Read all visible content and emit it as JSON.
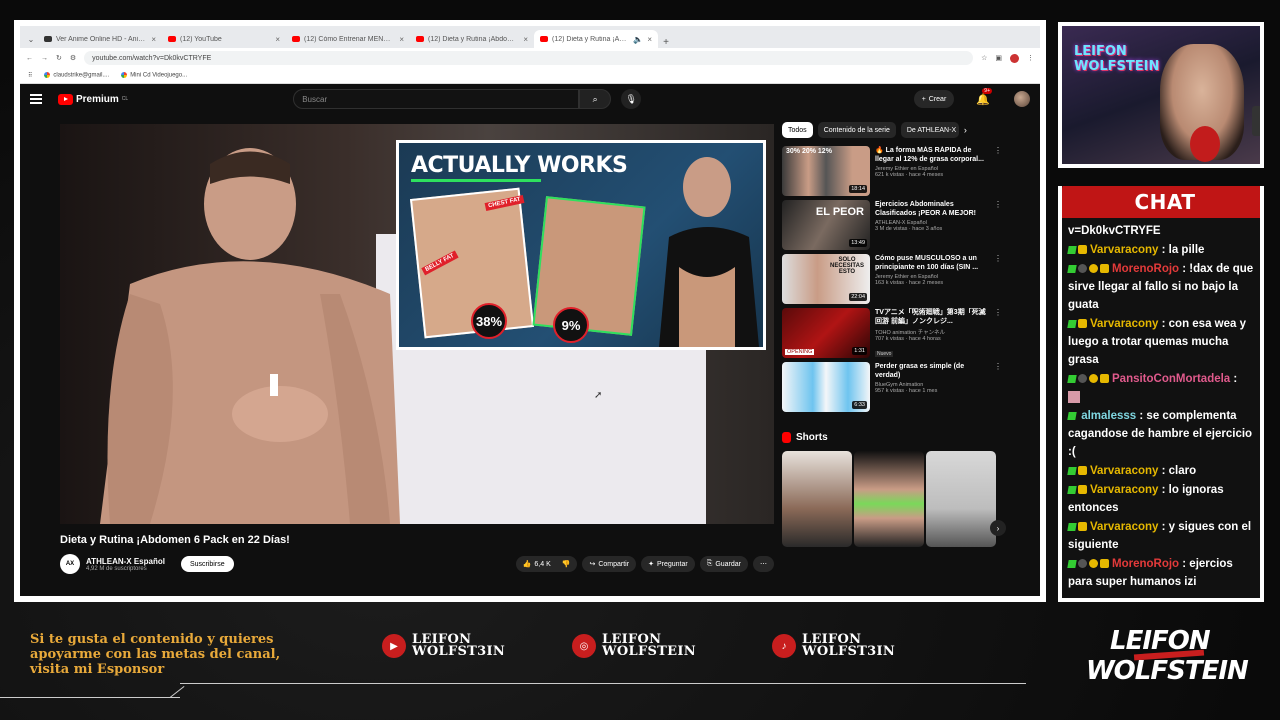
{
  "browser": {
    "tabs": [
      {
        "title": "Ver Anime Online HD - Animefl",
        "active": false
      },
      {
        "title": "(12) YouTube",
        "active": false
      },
      {
        "title": "(12) Cómo Entrenar MENOS co",
        "active": false
      },
      {
        "title": "(12) Dieta y Rutina ¡Abdomen 6",
        "active": false
      },
      {
        "title": "(12) Dieta y Rutina ¡Abdom",
        "active": true
      }
    ],
    "url": "youtube.com/watch?v=Dk0kvCTRYFE",
    "bookmarks": [
      "claudstrike@gmail....",
      "Mini Cd Videojuego..."
    ]
  },
  "youtube": {
    "logo": "Premium",
    "logo_region": "CL",
    "search_placeholder": "Buscar",
    "create_label": "Crear",
    "notif_count": "9+",
    "player_overlay": {
      "headline": "ACTUALLY WORKS",
      "tag1": "CHEST FAT",
      "tag2": "BELLY FAT",
      "pct1": "38%",
      "pct2": "9%"
    },
    "video_title": "Dieta y Rutina ¡Abdomen 6 Pack en 22 Días!",
    "channel": {
      "logo": "AX",
      "name": "ATHLEAN-X Español",
      "subs": "4,92 M de suscriptores",
      "subscribe": "Suscribirse"
    },
    "actions": {
      "likes": "6,4 K",
      "share": "Compartir",
      "ask": "Preguntar",
      "save": "Guardar"
    },
    "chips": [
      "Todos",
      "Contenido de la serie",
      "De ATHLEAN-X"
    ],
    "recommendations": [
      {
        "title": "🔥 La forma MÁS RÁPIDA de llegar al 12% de grasa corporal...",
        "channel": "Jeremy Ethier en Español",
        "meta": "621 k vistas · hace 4 meses",
        "duration": "18:14",
        "thumb_text": "30%  20%  12%"
      },
      {
        "title": "Ejercicios Abdominales Clasificados ¡PEOR A MEJOR!",
        "channel": "ATHLEAN-X Español",
        "meta": "3 M de vistas · hace 3 años",
        "duration": "13:49",
        "thumb_text": "EL PEOR"
      },
      {
        "title": "Cómo puse MUSCULOSO a un principiante en 100 días (SIN ...",
        "channel": "Jeremy Ethier en Español",
        "meta": "163 k vistas · hace 2 meses",
        "duration": "22:04",
        "thumb_text": "SOLO NECESITAS ESTO"
      },
      {
        "title": "TVアニメ「呪術廻戦」第3期「死滅回游 前編」ノンクレジ...",
        "channel": "TOHO animation チャンネル",
        "meta": "707 k vistas · hace 4 horas",
        "duration": "1:31",
        "badge": "Nuevo",
        "thumb_text": "OPENING"
      },
      {
        "title": "Perder grasa es simple (de verdad)",
        "channel": "BlueGym Animation",
        "meta": "957 k vistas · hace 1 mes",
        "duration": "6:33",
        "thumb_text": ""
      }
    ],
    "shorts_label": "Shorts"
  },
  "webcam": {
    "name_line1": "LEIFON",
    "name_line2": "WOLFSTEIN"
  },
  "chat": {
    "title": "CHAT",
    "messages": [
      {
        "user": "",
        "text": "v=Dk0kvCTRYFE"
      },
      {
        "user": "Varvaracony",
        "text": ": la pille"
      },
      {
        "user": "MorenoRojo",
        "text": ": !dax de que sirve llegar al fallo si no bajo la guata"
      },
      {
        "user": "Varvaracony",
        "text": ": con esa wea y luego a trotar quemas mucha grasa"
      },
      {
        "user": "PansitoConMortadela",
        "text": ":"
      },
      {
        "user": "almalesss",
        "text": ": se complementa cagandose de hambre el ejercicio :("
      },
      {
        "user": "Varvaracony",
        "text": ": claro"
      },
      {
        "user": "Varvaracony",
        "text": ": lo ignoras entonces"
      },
      {
        "user": "Varvaracony",
        "text": ": y sigues con el siguiente"
      },
      {
        "user": "MorenoRojo",
        "text": ": ejercios para super humanos izi"
      }
    ]
  },
  "footer": {
    "sponsor_text": "Si te gusta el contenido y quieres apoyarme con las metas del canal, visita mi Esponsor",
    "socials": [
      {
        "network": "youtube",
        "name_line1": "LEIFON",
        "name_line2": "WOLFST3IN"
      },
      {
        "network": "instagram",
        "name_line1": "LEIFON",
        "name_line2": "WOLFSTEIN"
      },
      {
        "network": "tiktok",
        "name_line1": "LEIFON",
        "name_line2": "WOLFST3IN"
      }
    ],
    "brand_line1": "LEIFON",
    "brand_line2": "WOLFSTEIN"
  },
  "colors": {
    "yt_red": "#ff0000",
    "chat_head": "#c01515",
    "sponsor_gold": "#e8a93a",
    "mod_green": "#33cc33",
    "sub_gold": "#e6b800"
  }
}
